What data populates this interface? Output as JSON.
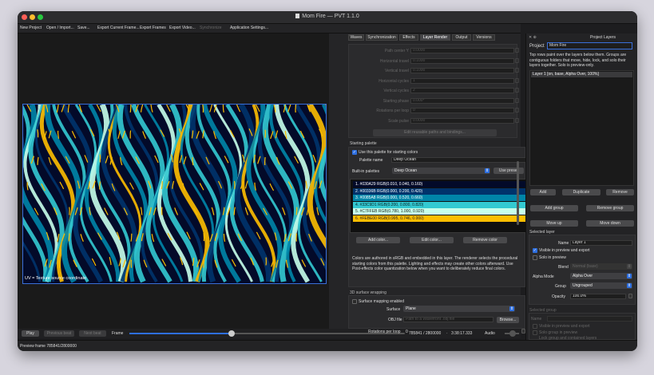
{
  "window": {
    "title": "Mom Fire — PVT 1.1.0",
    "traffic_colors": [
      "#ff5f57",
      "#febc2e",
      "#28c840"
    ]
  },
  "menubar": {
    "items": [
      {
        "label": "New Project",
        "enabled": true
      },
      {
        "label": "Open / Import...",
        "enabled": true
      },
      {
        "label": "Save...",
        "enabled": true
      },
      {
        "label": "Export Current Frame...",
        "enabled": true
      },
      {
        "label": "Export Frames",
        "enabled": true
      },
      {
        "label": "Export Video...",
        "enabled": true
      },
      {
        "label": "Synchronize",
        "enabled": false
      },
      {
        "label": "Application Settings...",
        "enabled": true
      }
    ]
  },
  "viewport": {
    "uv_label": "UV = Texture source coordinate"
  },
  "playbar": {
    "play_label": "Play",
    "prev_label": "Previous beat",
    "next_label": "Next beat",
    "frame_label": "Frame",
    "frame_slider": 0.37,
    "frame_readout": "785841 / 2800000",
    "time_readout": "3:38:17.333",
    "audio_label": "Audio"
  },
  "status": {
    "text": "Preview frame 785841/2800000"
  },
  "tabs": [
    {
      "label": "Waves",
      "active": false
    },
    {
      "label": "Synchronization",
      "active": false
    },
    {
      "label": "Effects",
      "active": false
    },
    {
      "label": "Layer Render",
      "active": true
    },
    {
      "label": "Output",
      "active": false
    },
    {
      "label": "Versions",
      "active": false
    }
  ],
  "motion": {
    "fields": [
      {
        "label": "Path center Y",
        "value": "0.0000"
      },
      {
        "label": "Horizontal travel",
        "value": "0.1000"
      },
      {
        "label": "Vertical travel",
        "value": "0.1000"
      },
      {
        "label": "Horizontal cycles",
        "value": "1"
      },
      {
        "label": "Vertical cycles",
        "value": "2"
      },
      {
        "label": "Starting phase",
        "value": "0.000°"
      },
      {
        "label": "Rotations per loop",
        "value": "0"
      },
      {
        "label": "Scale pulse",
        "value": "0.0000"
      }
    ],
    "edit_button": "Edit reusable paths and bindings..."
  },
  "starting_palette": {
    "section_title": "Starting palette",
    "use_label": "Use this palette for starting colors",
    "use_checked": true,
    "name_label": "Palette name",
    "name_value": "Deep Ocean",
    "builtin_label": "Built-in palettes",
    "builtin_value": "Deep Ocean",
    "use_preset": "Use preset",
    "colors": [
      {
        "text": "1. #030A29   RGB(0.010, 0.040, 0.160)",
        "bg": "#030a29",
        "fg": "#ffffff"
      },
      {
        "text": "2. #00336B   RGB(0.000, 0.200, 0.420)",
        "bg": "#00336b",
        "fg": "#ffffff"
      },
      {
        "text": "3. #0085A8   RGB(0.000, 0.520, 0.660)",
        "bg": "#0085a8",
        "fg": "#ffffff"
      },
      {
        "text": "4. #33C9D1   RGB(0.200, 0.800, 0.820)",
        "bg": "#33c9d1",
        "fg": "#062226"
      },
      {
        "text": "5. #C7FFEB   RGB(0.780, 1.000, 0.920)",
        "bg": "#c7ffeb",
        "fg": "#222222"
      },
      {
        "text": "6. #FEBE00   RGB(0.995, 0.746, 0.000)",
        "bg": "#febe00",
        "fg": "#222222"
      }
    ],
    "add_color": "Add color...",
    "edit_color": "Edit color...",
    "remove_color": "Remove color",
    "description": "Colors are authored in sRGB and embedded in this layer. The renderer selects the procedural starting colors from this palette. Lighting and effects may create other colors afterward. Use Post-effects color quantization below when you want to deliberately reduce final colors."
  },
  "surface": {
    "section_title": "3D surface wrapping",
    "enabled_label": "Surface mapping enabled",
    "enabled_checked": false,
    "surface_label": "Surface",
    "surface_value": "Plane",
    "obj_label": "OBJ file",
    "obj_placeholder": "Path to a Wavefront .obj file",
    "browse": "Browse...",
    "rotations_label": "Rotations per loop",
    "rotations_value": "0"
  },
  "layers_panel": {
    "title": "Project Layers",
    "project_label": "Project",
    "project_value": "Mom Fire",
    "help": "Top rows paint over the layers below them. Groups are contiguous folders that move, hide, lock, and solo their layers together. Solo is preview-only.",
    "layers": [
      "Layer 1  [on, base, Alpha Over, 100%]"
    ],
    "add": "Add",
    "duplicate": "Duplicate",
    "remove": "Remove",
    "add_group": "Add group",
    "remove_group": "Remove group",
    "move_up": "Move up",
    "move_down": "Move down",
    "selected_layer": "Selected layer",
    "name_label": "Name",
    "name_value": "Layer 1",
    "visible_label": "Visible in preview and export",
    "visible_checked": true,
    "solo_label": "Solo in preview",
    "solo_checked": false,
    "blend_label": "Blend",
    "blend_value": "Normal (base)",
    "alpha_label": "Alpha Mode",
    "alpha_value": "Alpha Over",
    "group_label": "Group",
    "group_value": "Ungrouped",
    "opacity_label": "Opacity",
    "opacity_value": "100.0%",
    "selected_group": "Selected group",
    "g_name_label": "Name",
    "g_visible": "Visible in preview and export",
    "g_solo": "Solo group in preview",
    "g_lock": "Lock group and contained layers"
  },
  "render_colors": [
    "#030a29",
    "#00336b",
    "#0085a8",
    "#33c9d1",
    "#c7ffeb",
    "#febe00"
  ]
}
